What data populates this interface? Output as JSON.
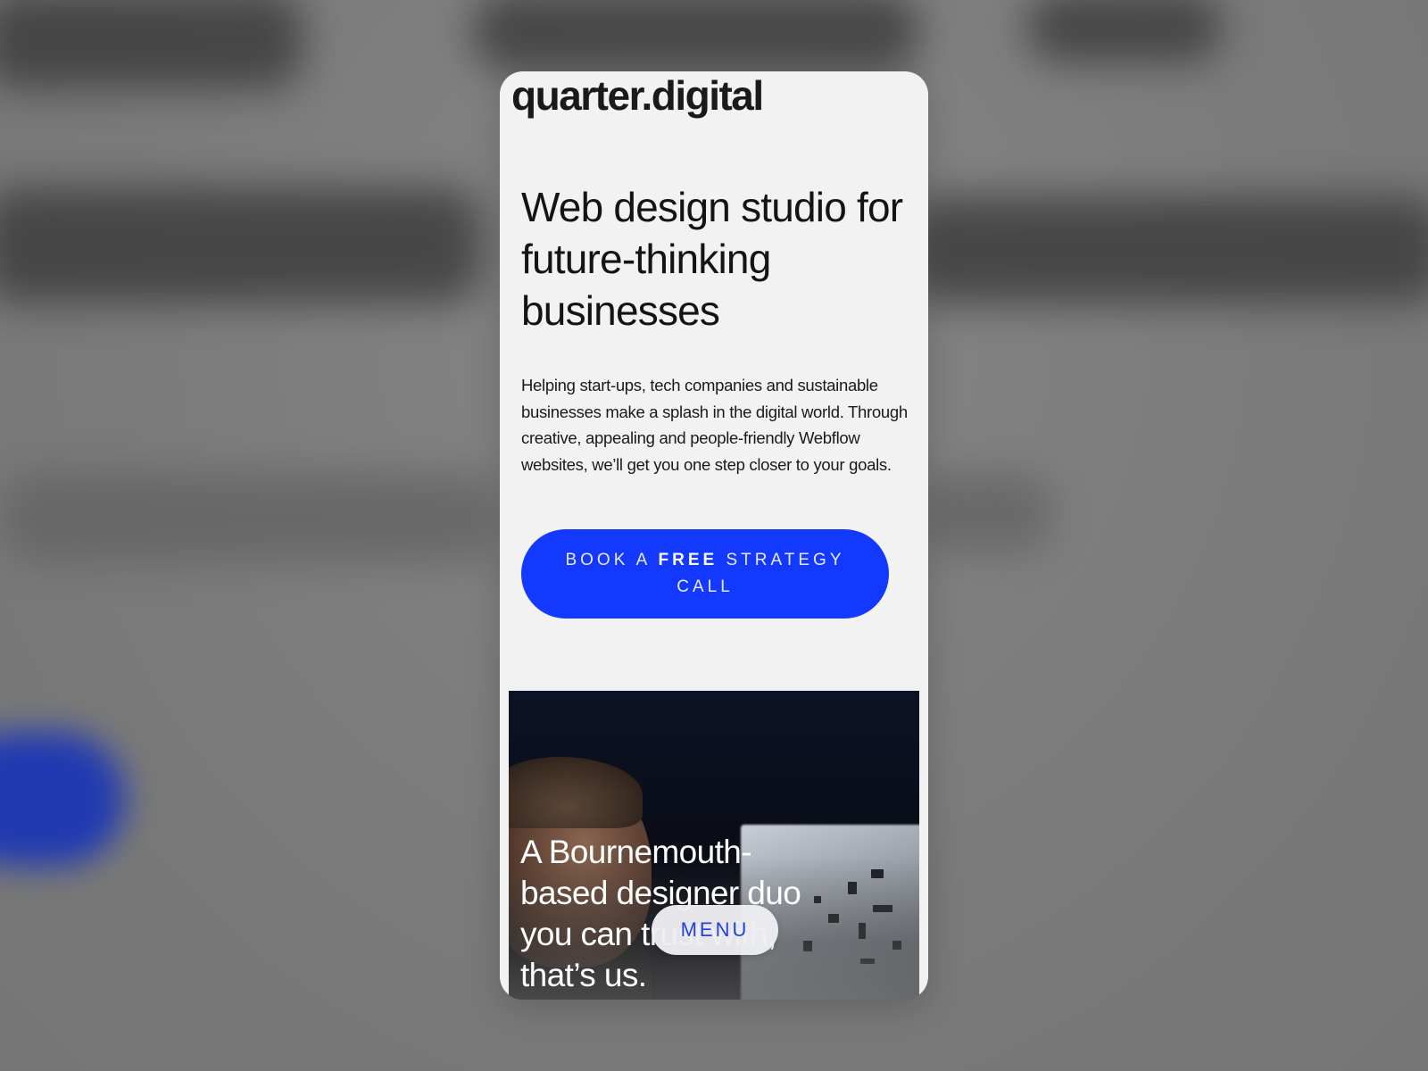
{
  "header": {
    "logo_text": "quarter.digital"
  },
  "hero": {
    "headline": "Web design studio for future-thinking businesses",
    "intro": "Helping start-ups, tech companies and sustainable businesses make a splash in the digital world. Through creative, appealing and people-friendly Webflow websites, we’ll get you one step closer to your goals.",
    "cta": {
      "prefix": "BOOK A ",
      "emphasis": "FREE",
      "suffix": " STRATEGY CALL"
    }
  },
  "image_section": {
    "tagline": "A Bournemouth-based designer duo you can trust with, that’s us."
  },
  "navigation": {
    "menu_label": "MENU"
  },
  "colors": {
    "accent": "#1339ff",
    "page_background": "#f2f2f2",
    "backdrop": "#7a7a7a"
  }
}
